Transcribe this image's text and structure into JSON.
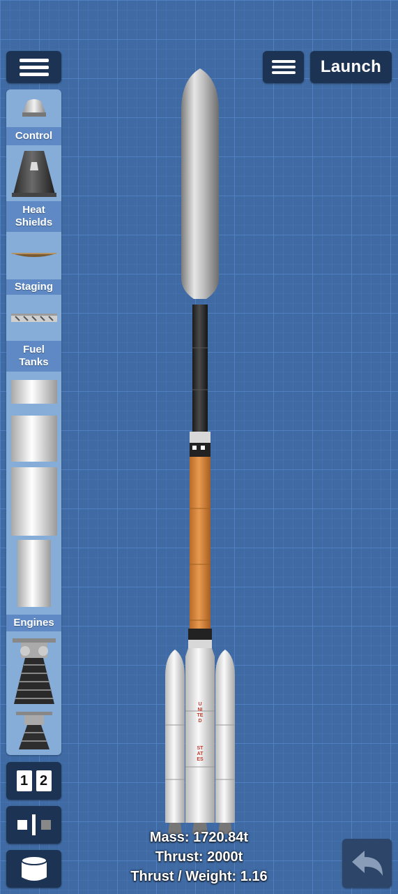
{
  "toolbar": {
    "left_menu_icon": "hamburger-menu-icon",
    "right_menu_icon": "hamburger-menu-icon",
    "launch_label": "Launch"
  },
  "parts_panel": {
    "categories": [
      {
        "label": "Control"
      },
      {
        "label": "Heat\nShields"
      },
      {
        "label": "Staging"
      },
      {
        "label": "Fuel\nTanks"
      },
      {
        "label": "Engines"
      }
    ],
    "parts": [
      {
        "icon": "probe-capsule-icon"
      },
      {
        "icon": "command-capsule-icon"
      },
      {
        "icon": "heat-shield-icon"
      },
      {
        "icon": "separator-icon"
      },
      {
        "icon": "fuel-tank-small-icon"
      },
      {
        "icon": "fuel-tank-medium-icon"
      },
      {
        "icon": "fuel-tank-large-icon"
      },
      {
        "icon": "fuel-tank-narrow-icon"
      },
      {
        "icon": "large-engine-icon"
      },
      {
        "icon": "small-engine-icon"
      }
    ]
  },
  "bottom_tools": {
    "stage_numbers": [
      "1",
      "2"
    ],
    "symmetry_icon": "symmetry-icon",
    "storage_icon": "storage-cylinder-icon",
    "undo_icon": "undo-arrow-icon"
  },
  "rocket": {
    "booster_text_1": "UNITED",
    "booster_text_2": "STATES",
    "colors": {
      "fairing": "#b4b4b4",
      "interstage": "#2c2c2c",
      "orange_tank": "#d98a3c",
      "boosters": "#e6e6e6"
    }
  },
  "stats": {
    "mass": "Mass: 1720.84t",
    "thrust": "Thrust: 2000t",
    "twr": "Thrust / Weight: 1.16"
  }
}
